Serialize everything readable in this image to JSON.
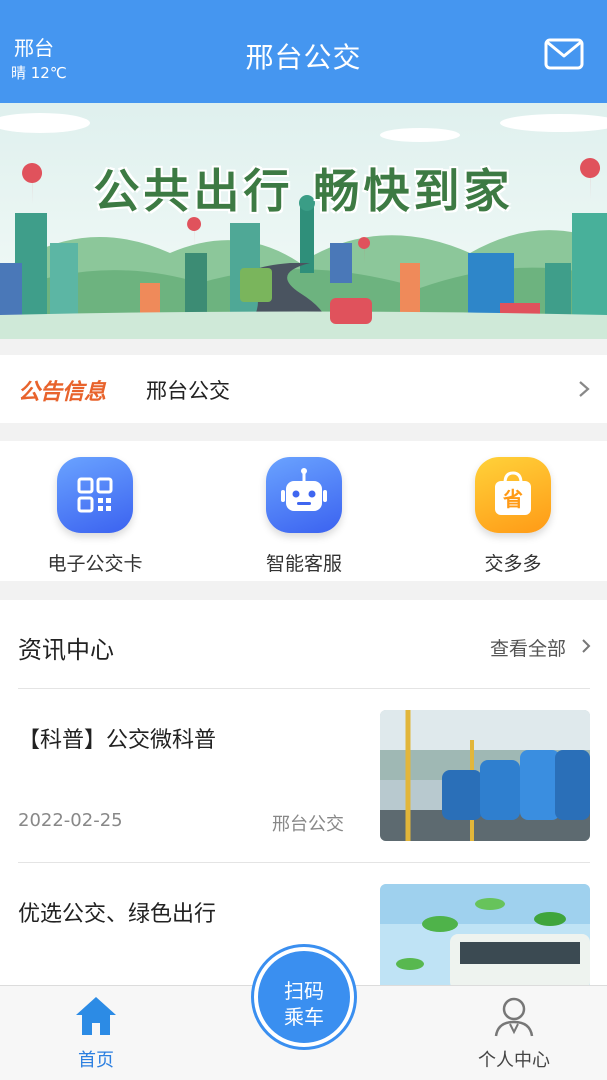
{
  "header": {
    "city": "邢台",
    "weather": "晴 12℃",
    "title": "邢台公交",
    "mail_icon": "mail-icon"
  },
  "banner": {
    "text": "公共出行  畅快到家"
  },
  "notice": {
    "tag": "公告信息",
    "text": "邢台公交"
  },
  "services": [
    {
      "label": "电子公交卡",
      "icon": "qr-code-icon"
    },
    {
      "label": "智能客服",
      "icon": "robot-icon"
    },
    {
      "label": "交多多",
      "icon": "shopping-bag-icon"
    }
  ],
  "news": {
    "title": "资讯中心",
    "more": "查看全部",
    "articles": [
      {
        "title": "【科普】公交微科普",
        "date": "2022-02-25",
        "source": "邢台公交"
      },
      {
        "title": "优选公交、绿色出行"
      }
    ]
  },
  "nav": {
    "home": "首页",
    "scan_line1": "扫码",
    "scan_line2": "乘车",
    "profile": "个人中心"
  },
  "colors": {
    "primary": "#4596f0",
    "notice_tag": "#e8632c",
    "active_nav": "#2c7fe0"
  }
}
